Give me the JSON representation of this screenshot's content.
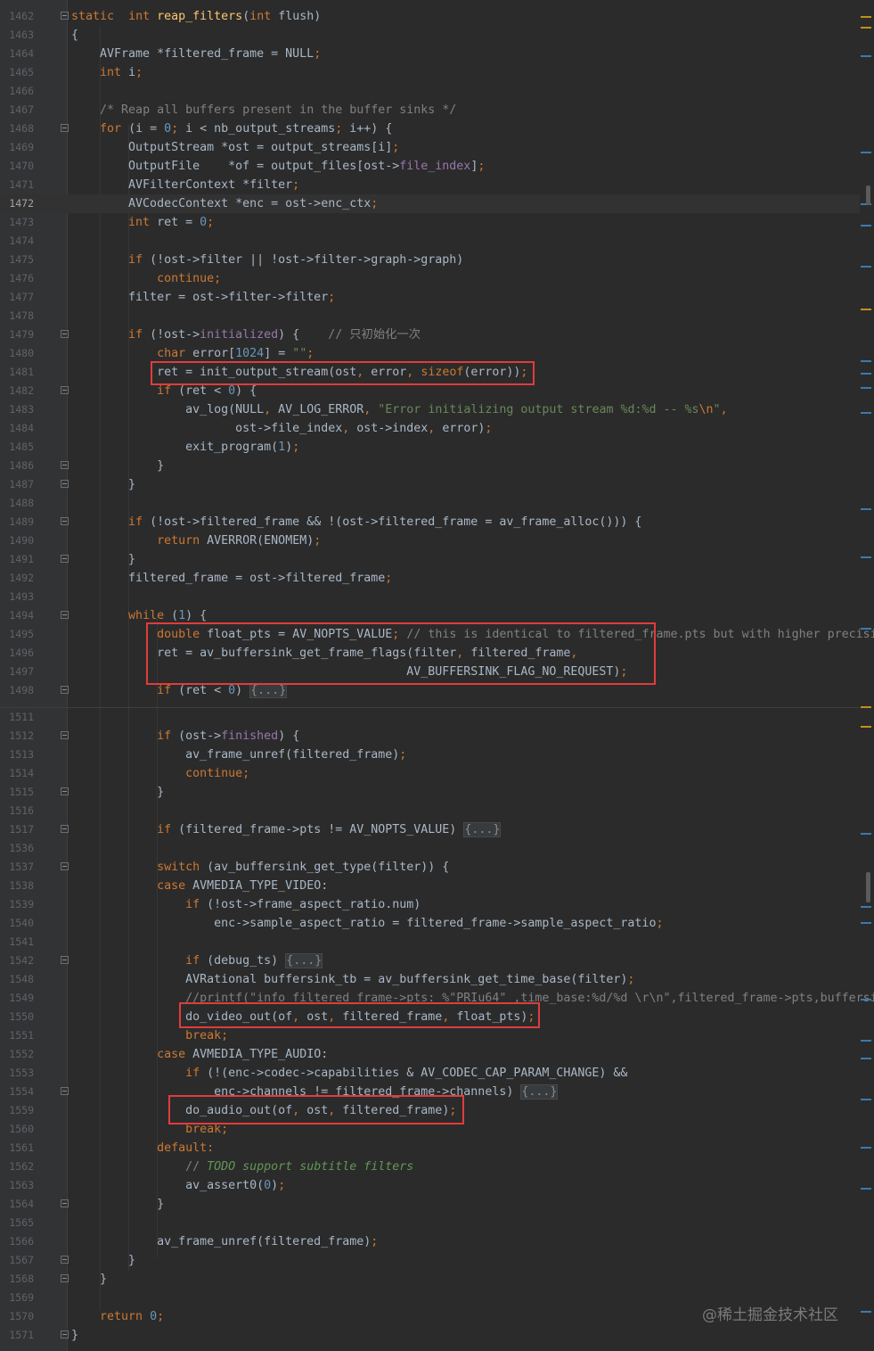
{
  "editor": {
    "current_line": "1472",
    "watermark": "@稀土掘金技术社区",
    "lines": [
      {
        "num": "1462",
        "tokens": [
          [
            "k",
            "static"
          ],
          [
            "",
            "  "
          ],
          [
            "k",
            "int"
          ],
          [
            "",
            " "
          ],
          [
            "f",
            "reap_filters"
          ],
          [
            "",
            "("
          ],
          [
            "k",
            "int"
          ],
          [
            "",
            " flush)"
          ]
        ],
        "fold": true,
        "flush": true
      },
      {
        "num": "1463",
        "tokens": [
          [
            "",
            "{"
          ]
        ]
      },
      {
        "num": "1464",
        "tokens": [
          [
            "",
            "    AVFrame *filtered_frame = NULL"
          ],
          [
            "k",
            ";"
          ]
        ]
      },
      {
        "num": "1465",
        "tokens": [
          [
            "",
            "    "
          ],
          [
            "k",
            "int"
          ],
          [
            "",
            " i"
          ],
          [
            "k",
            ";"
          ]
        ]
      },
      {
        "num": "1466",
        "tokens": []
      },
      {
        "num": "1467",
        "tokens": [
          [
            "",
            "    "
          ],
          [
            "c",
            "/* Reap all buffers present in the buffer sinks */"
          ]
        ]
      },
      {
        "num": "1468",
        "tokens": [
          [
            "",
            "    "
          ],
          [
            "k",
            "for"
          ],
          [
            "",
            " (i = "
          ],
          [
            "n",
            "0"
          ],
          [
            "k",
            ";"
          ],
          [
            "",
            " i < nb_output_streams"
          ],
          [
            "k",
            ";"
          ],
          [
            "",
            " i++) {"
          ]
        ],
        "fold": true
      },
      {
        "num": "1469",
        "tokens": [
          [
            "",
            "        OutputStream *ost = output_streams[i]"
          ],
          [
            "k",
            ";"
          ]
        ]
      },
      {
        "num": "1470",
        "tokens": [
          [
            "",
            "        OutputFile    *of = output_files[ost->"
          ],
          [
            "m",
            "file_index"
          ],
          [
            "",
            "]"
          ],
          [
            "k",
            ";"
          ]
        ]
      },
      {
        "num": "1471",
        "tokens": [
          [
            "",
            "        AVFilterContext *filter"
          ],
          [
            "k",
            ";"
          ]
        ]
      },
      {
        "num": "1472",
        "tokens": [
          [
            "",
            "        AVCodecContext *enc = ost->enc_ctx"
          ],
          [
            "k",
            ";"
          ]
        ]
      },
      {
        "num": "1473",
        "tokens": [
          [
            "",
            "        "
          ],
          [
            "k",
            "int"
          ],
          [
            "",
            " ret = "
          ],
          [
            "n",
            "0"
          ],
          [
            "k",
            ";"
          ]
        ]
      },
      {
        "num": "1474",
        "tokens": []
      },
      {
        "num": "1475",
        "tokens": [
          [
            "",
            "        "
          ],
          [
            "k",
            "if"
          ],
          [
            "",
            " (!ost->filter || !ost->filter->graph->graph)"
          ]
        ]
      },
      {
        "num": "1476",
        "tokens": [
          [
            "",
            "            "
          ],
          [
            "k",
            "continue;"
          ]
        ]
      },
      {
        "num": "1477",
        "tokens": [
          [
            "",
            "        filter = ost->filter->filter"
          ],
          [
            "k",
            ";"
          ]
        ]
      },
      {
        "num": "1478",
        "tokens": []
      },
      {
        "num": "1479",
        "tokens": [
          [
            "",
            "        "
          ],
          [
            "k",
            "if"
          ],
          [
            "",
            " (!ost->"
          ],
          [
            "m",
            "initialized"
          ],
          [
            "",
            ") {    "
          ],
          [
            "c",
            "// 只初始化一次"
          ]
        ],
        "fold": true
      },
      {
        "num": "1480",
        "tokens": [
          [
            "",
            "            "
          ],
          [
            "k",
            "char"
          ],
          [
            "",
            " error["
          ],
          [
            "n",
            "1024"
          ],
          [
            "",
            "] = "
          ],
          [
            "s",
            "\"\""
          ],
          [
            "k",
            ";"
          ]
        ]
      },
      {
        "num": "1481",
        "tokens": [
          [
            "",
            "            ret = init_output_stream(ost"
          ],
          [
            "k",
            ","
          ],
          [
            "",
            " error"
          ],
          [
            "k",
            ","
          ],
          [
            "",
            " "
          ],
          [
            "k",
            "sizeof"
          ],
          [
            "",
            "(error))"
          ],
          [
            "k",
            ";"
          ]
        ]
      },
      {
        "num": "1482",
        "tokens": [
          [
            "",
            "            "
          ],
          [
            "k",
            "if"
          ],
          [
            "",
            " (ret < "
          ],
          [
            "n",
            "0"
          ],
          [
            "",
            ") {"
          ]
        ],
        "fold": true
      },
      {
        "num": "1483",
        "tokens": [
          [
            "",
            "                av_log(NULL"
          ],
          [
            "k",
            ","
          ],
          [
            "",
            " AV_LOG_ERROR"
          ],
          [
            "k",
            ","
          ],
          [
            "",
            " "
          ],
          [
            "s",
            "\"Error initializing output stream %d:%d -- %s"
          ],
          [
            "k",
            "\\n"
          ],
          [
            "s",
            "\""
          ],
          [
            "k",
            ","
          ]
        ]
      },
      {
        "num": "1484",
        "tokens": [
          [
            "",
            "                       ost->file_index"
          ],
          [
            "k",
            ","
          ],
          [
            "",
            " ost->index"
          ],
          [
            "k",
            ","
          ],
          [
            "",
            " error)"
          ],
          [
            "k",
            ";"
          ]
        ]
      },
      {
        "num": "1485",
        "tokens": [
          [
            "",
            "                exit_program("
          ],
          [
            "n",
            "1"
          ],
          [
            "",
            ")"
          ],
          [
            "k",
            ";"
          ]
        ]
      },
      {
        "num": "1486",
        "tokens": [
          [
            "",
            "            }"
          ]
        ],
        "fold": true
      },
      {
        "num": "1487",
        "tokens": [
          [
            "",
            "        }"
          ]
        ],
        "fold": true
      },
      {
        "num": "1488",
        "tokens": []
      },
      {
        "num": "1489",
        "tokens": [
          [
            "",
            "        "
          ],
          [
            "k",
            "if"
          ],
          [
            "",
            " (!ost->filtered_frame && !(ost->filtered_frame = av_frame_alloc())) {"
          ]
        ],
        "fold": true
      },
      {
        "num": "1490",
        "tokens": [
          [
            "",
            "            "
          ],
          [
            "k",
            "return"
          ],
          [
            "",
            " AVERROR(ENOMEM)"
          ],
          [
            "k",
            ";"
          ]
        ]
      },
      {
        "num": "1491",
        "tokens": [
          [
            "",
            "        }"
          ]
        ],
        "fold": true
      },
      {
        "num": "1492",
        "tokens": [
          [
            "",
            "        filtered_frame = ost->filtered_frame"
          ],
          [
            "k",
            ";"
          ]
        ]
      },
      {
        "num": "1493",
        "tokens": []
      },
      {
        "num": "1494",
        "tokens": [
          [
            "",
            "        "
          ],
          [
            "k",
            "while"
          ],
          [
            "",
            " ("
          ],
          [
            "n",
            "1"
          ],
          [
            "",
            ") {"
          ]
        ],
        "fold": true
      },
      {
        "num": "1495",
        "tokens": [
          [
            "",
            "            "
          ],
          [
            "k",
            "double"
          ],
          [
            "",
            " float_pts = AV_NOPTS_VALUE"
          ],
          [
            "k",
            ";"
          ],
          [
            "",
            " "
          ],
          [
            "c",
            "// this is identical to filtered_frame.pts but with higher precision"
          ]
        ]
      },
      {
        "num": "1496",
        "tokens": [
          [
            "",
            "            ret = av_buffersink_get_frame_flags(filter"
          ],
          [
            "k",
            ","
          ],
          [
            "",
            " filtered_frame"
          ],
          [
            "k",
            ","
          ]
        ]
      },
      {
        "num": "1497",
        "tokens": [
          [
            "",
            "                                               AV_BUFFERSINK_FLAG_NO_REQUEST)"
          ],
          [
            "k",
            ";"
          ]
        ]
      },
      {
        "num": "1498",
        "tokens": [
          [
            "",
            "            "
          ],
          [
            "k",
            "if"
          ],
          [
            "",
            " (ret < "
          ],
          [
            "n",
            "0"
          ],
          [
            "",
            ") "
          ],
          [
            "fo",
            "{...}"
          ]
        ],
        "fold": true
      },
      {
        "num": "1511",
        "tokens": [],
        "gap": true
      },
      {
        "num": "1512",
        "tokens": [
          [
            "",
            "            "
          ],
          [
            "k",
            "if"
          ],
          [
            "",
            " (ost->"
          ],
          [
            "m",
            "finished"
          ],
          [
            "",
            ") {"
          ]
        ],
        "fold": true
      },
      {
        "num": "1513",
        "tokens": [
          [
            "",
            "                av_frame_unref(filtered_frame)"
          ],
          [
            "k",
            ";"
          ]
        ]
      },
      {
        "num": "1514",
        "tokens": [
          [
            "",
            "                "
          ],
          [
            "k",
            "continue;"
          ]
        ]
      },
      {
        "num": "1515",
        "tokens": [
          [
            "",
            "            }"
          ]
        ],
        "fold": true
      },
      {
        "num": "1516",
        "tokens": []
      },
      {
        "num": "1517",
        "tokens": [
          [
            "",
            "            "
          ],
          [
            "k",
            "if"
          ],
          [
            "",
            " (filtered_frame->pts != AV_NOPTS_VALUE) "
          ],
          [
            "fo",
            "{...}"
          ]
        ],
        "fold": true
      },
      {
        "num": "1536",
        "tokens": []
      },
      {
        "num": "1537",
        "tokens": [
          [
            "",
            "            "
          ],
          [
            "k",
            "switch"
          ],
          [
            "",
            " (av_buffersink_get_type(filter)) {"
          ]
        ],
        "fold": true
      },
      {
        "num": "1538",
        "tokens": [
          [
            "",
            "            "
          ],
          [
            "k",
            "case"
          ],
          [
            "",
            " AVMEDIA_TYPE_VIDEO:"
          ]
        ]
      },
      {
        "num": "1539",
        "tokens": [
          [
            "",
            "                "
          ],
          [
            "k",
            "if"
          ],
          [
            "",
            " (!ost->frame_aspect_ratio.num)"
          ]
        ]
      },
      {
        "num": "1540",
        "tokens": [
          [
            "",
            "                    enc->sample_aspect_ratio = filtered_frame->sample_aspect_ratio"
          ],
          [
            "k",
            ";"
          ]
        ]
      },
      {
        "num": "1541",
        "tokens": []
      },
      {
        "num": "1542",
        "tokens": [
          [
            "",
            "                "
          ],
          [
            "k",
            "if"
          ],
          [
            "",
            " (debug_ts) "
          ],
          [
            "fo",
            "{...}"
          ]
        ],
        "fold": true
      },
      {
        "num": "1548",
        "tokens": [
          [
            "",
            "                AVRational buffersink_tb = av_buffersink_get_time_base(filter)"
          ],
          [
            "k",
            ";"
          ]
        ]
      },
      {
        "num": "1549",
        "tokens": [
          [
            "",
            "                "
          ],
          [
            "c",
            "//printf(\"info filtered_frame->pts: %\"PRIu64\" ,time_base:%d/%d \\r\\n\",filtered_frame->pts,buffersink_tb"
          ]
        ]
      },
      {
        "num": "1550",
        "tokens": [
          [
            "",
            "                do_video_out(of"
          ],
          [
            "k",
            ","
          ],
          [
            "",
            " ost"
          ],
          [
            "k",
            ","
          ],
          [
            "",
            " filtered_frame"
          ],
          [
            "k",
            ","
          ],
          [
            "",
            " float_pts)"
          ],
          [
            "k",
            ";"
          ]
        ]
      },
      {
        "num": "1551",
        "tokens": [
          [
            "",
            "                "
          ],
          [
            "k",
            "break;"
          ]
        ]
      },
      {
        "num": "1552",
        "tokens": [
          [
            "",
            "            "
          ],
          [
            "k",
            "case"
          ],
          [
            "",
            " AVMEDIA_TYPE_AUDIO:"
          ]
        ]
      },
      {
        "num": "1553",
        "tokens": [
          [
            "",
            "                "
          ],
          [
            "k",
            "if"
          ],
          [
            "",
            " (!(enc->codec->capabilities & AV_CODEC_CAP_PARAM_CHANGE) &&"
          ]
        ]
      },
      {
        "num": "1554",
        "tokens": [
          [
            "",
            "                    enc->channels != filtered_frame->channels) "
          ],
          [
            "fo",
            "{...}"
          ]
        ],
        "fold": true
      },
      {
        "num": "1559",
        "tokens": [
          [
            "",
            "                do_audio_out(of"
          ],
          [
            "k",
            ","
          ],
          [
            "",
            " ost"
          ],
          [
            "k",
            ","
          ],
          [
            "",
            " filtered_frame)"
          ],
          [
            "k",
            ";"
          ]
        ]
      },
      {
        "num": "1560",
        "tokens": [
          [
            "",
            "                "
          ],
          [
            "k",
            "break;"
          ]
        ]
      },
      {
        "num": "1561",
        "tokens": [
          [
            "",
            "            "
          ],
          [
            "k",
            "default:"
          ]
        ]
      },
      {
        "num": "1562",
        "tokens": [
          [
            "",
            "                "
          ],
          [
            "c",
            "// "
          ],
          [
            "ci",
            "TODO support subtitle filters"
          ]
        ]
      },
      {
        "num": "1563",
        "tokens": [
          [
            "",
            "                av_assert0("
          ],
          [
            "n",
            "0"
          ],
          [
            "",
            ")"
          ],
          [
            "k",
            ";"
          ]
        ]
      },
      {
        "num": "1564",
        "tokens": [
          [
            "",
            "            }"
          ]
        ],
        "fold": true
      },
      {
        "num": "1565",
        "tokens": []
      },
      {
        "num": "1566",
        "tokens": [
          [
            "",
            "            av_frame_unref(filtered_frame)"
          ],
          [
            "k",
            ";"
          ]
        ]
      },
      {
        "num": "1567",
        "tokens": [
          [
            "",
            "        }"
          ]
        ],
        "fold": true
      },
      {
        "num": "1568",
        "tokens": [
          [
            "",
            "    }"
          ]
        ],
        "fold": true
      },
      {
        "num": "1569",
        "tokens": []
      },
      {
        "num": "1570",
        "tokens": [
          [
            "",
            "    "
          ],
          [
            "k",
            "return"
          ],
          [
            "",
            " "
          ],
          [
            "n",
            "0"
          ],
          [
            "k",
            ";"
          ]
        ]
      },
      {
        "num": "1571",
        "tokens": [
          [
            "",
            "}"
          ]
        ],
        "fold": true
      }
    ]
  },
  "colors": {
    "background": "#2b2b2b",
    "gutter": "#313335",
    "keyword": "#cc7832",
    "function": "#ffc66d",
    "number": "#6897bb",
    "string": "#6a8759",
    "comment": "#808080",
    "field": "#9876aa",
    "highlight_box": "#e03c3c"
  }
}
